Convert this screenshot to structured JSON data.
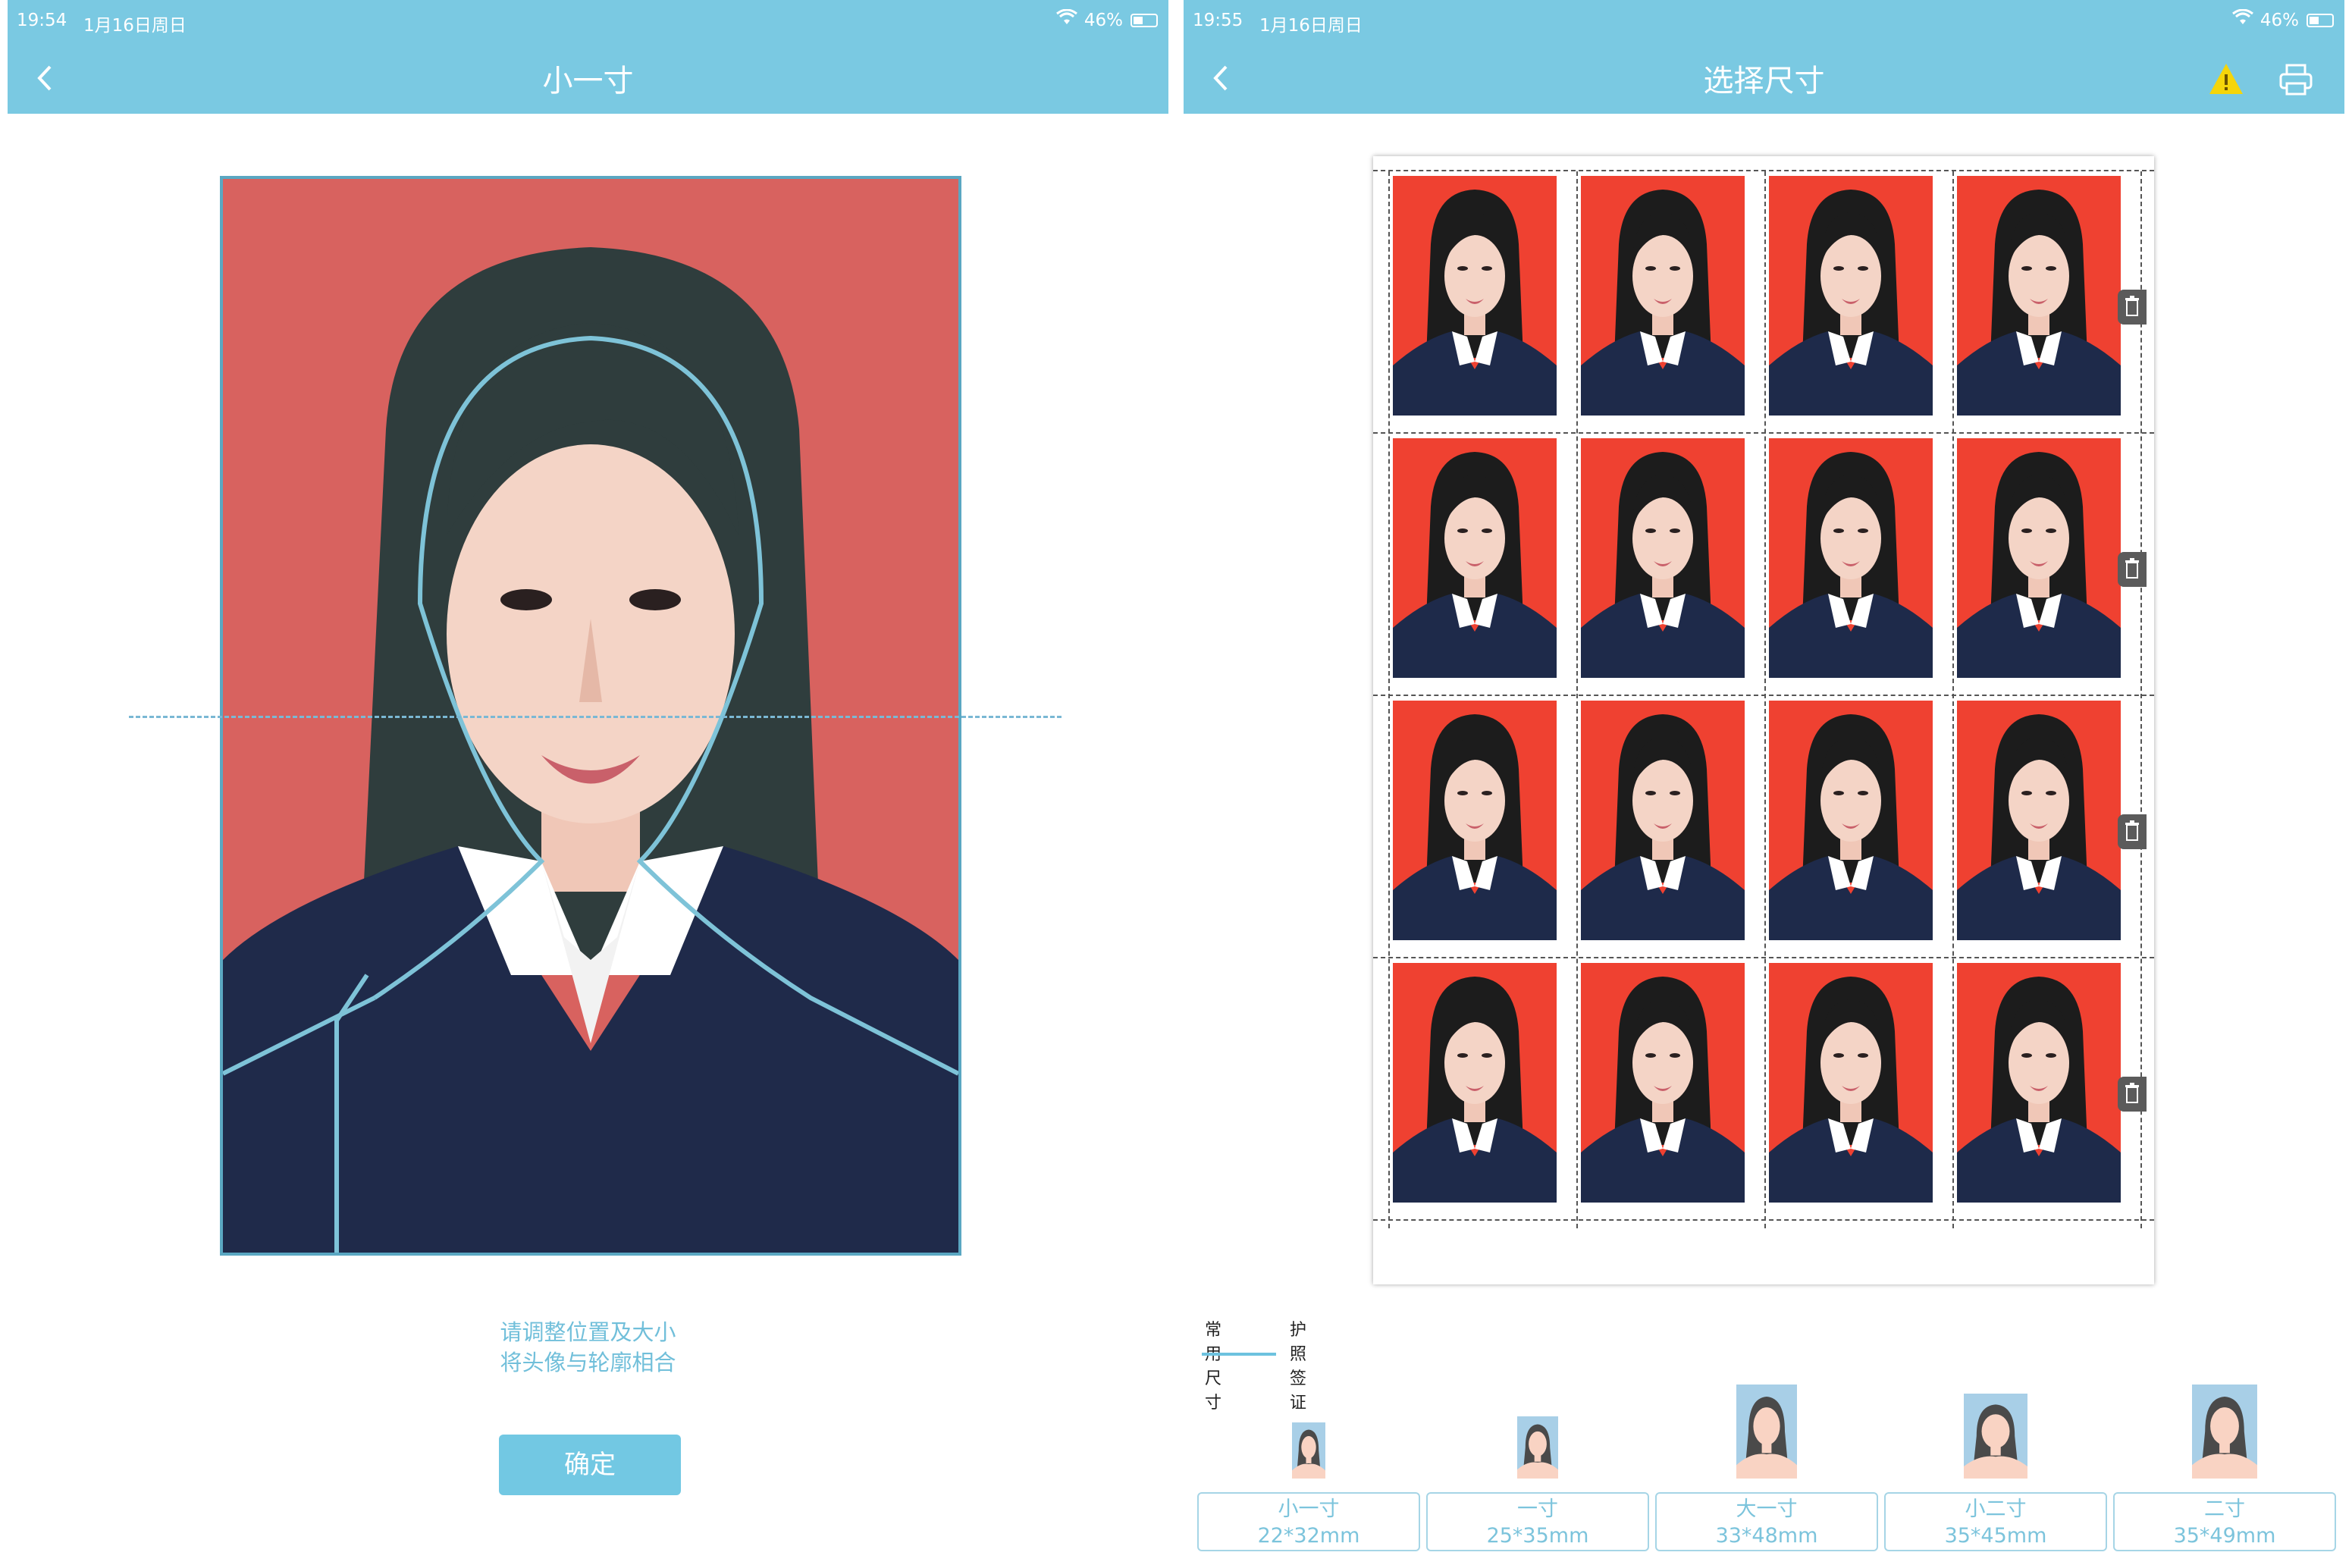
{
  "left": {
    "status": {
      "time": "19:54",
      "date": "1月16日周日",
      "battery": "46%"
    },
    "nav": {
      "title": "小一寸"
    },
    "hint": {
      "line1": "请调整位置及大小",
      "line2": "将头像与轮廓相合"
    },
    "confirm_label": "确定"
  },
  "right": {
    "status": {
      "time": "19:55",
      "date": "1月16日周日",
      "battery": "46%"
    },
    "nav": {
      "title": "选择尺寸"
    },
    "sheet": {
      "rows": 4,
      "cols": 4
    },
    "tabs": [
      {
        "label": "常用尺寸",
        "active": true
      },
      {
        "label": "护照签证",
        "active": false
      }
    ],
    "sizes": [
      {
        "name": "小一寸",
        "dim": "22*32mm"
      },
      {
        "name": "一寸",
        "dim": "25*35mm"
      },
      {
        "name": "大一寸",
        "dim": "33*48mm"
      },
      {
        "name": "小二寸",
        "dim": "35*45mm"
      },
      {
        "name": "二寸",
        "dim": "35*49mm"
      }
    ]
  },
  "colors": {
    "header": "#7ac9e2",
    "accent": "#72c8e3",
    "photo_bg_left": "#d8625f",
    "photo_bg_right": "#ef4131",
    "warning": "#f5d50a"
  },
  "icons": [
    "back-icon",
    "wifi-icon",
    "battery-icon",
    "warning-icon",
    "printer-icon",
    "trash-icon"
  ]
}
